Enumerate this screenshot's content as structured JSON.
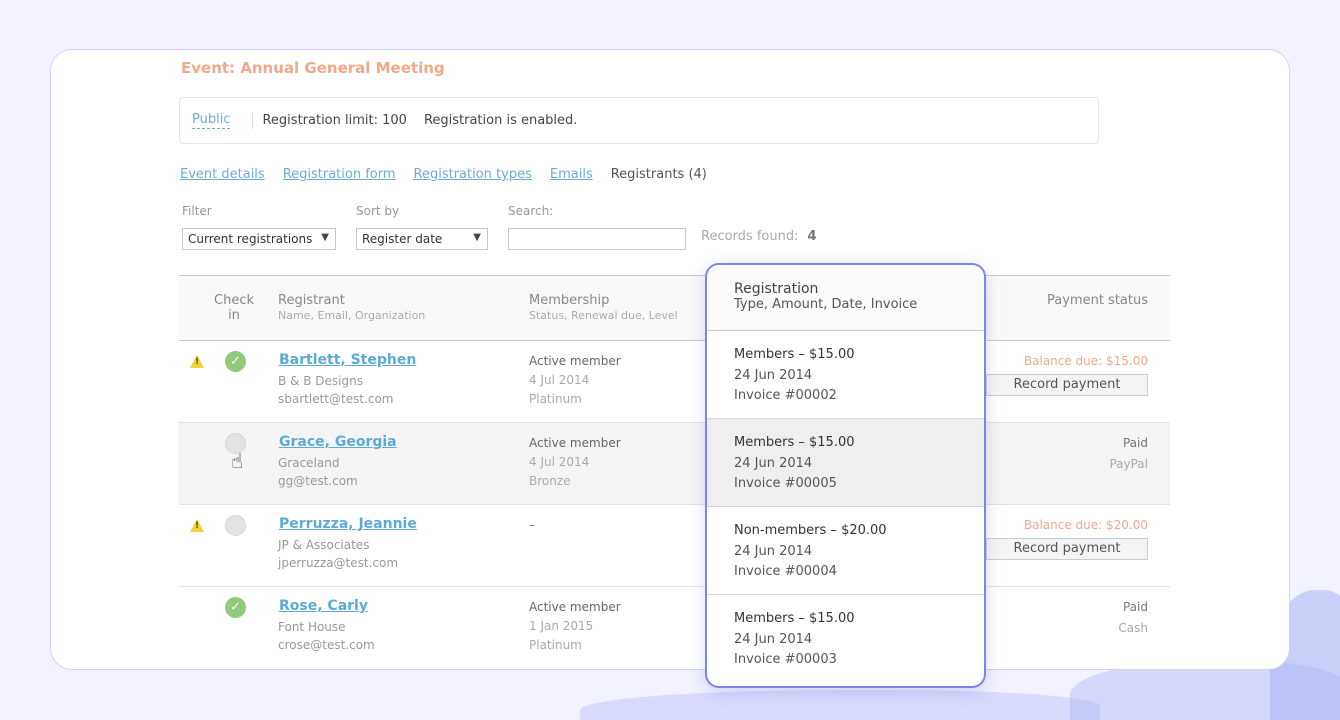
{
  "event": {
    "title": "Event: Annual General Meeting",
    "visibility": "Public",
    "registration_limit": "Registration limit: 100",
    "registration_status": "Registration is enabled."
  },
  "tabs": [
    {
      "label": "Event details",
      "active": false
    },
    {
      "label": "Registration form",
      "active": false
    },
    {
      "label": "Registration types",
      "active": false
    },
    {
      "label": "Emails",
      "active": false
    },
    {
      "label": "Registrants (4)",
      "active": true
    }
  ],
  "controls": {
    "filter_label": "Filter",
    "filter_value": "Current registrations",
    "sort_label": "Sort by",
    "sort_value": "Register date",
    "search_label": "Search:",
    "search_value": "",
    "records_label": "Records found:",
    "records_count": "4"
  },
  "table": {
    "headers": {
      "checkin": "Check in",
      "registrant": "Registrant",
      "registrant_sub": "Name, Email, Organization",
      "membership": "Membership",
      "membership_sub": "Status, Renewal due, Level",
      "payment": "Payment status"
    },
    "rows": [
      {
        "warning": true,
        "checked_in": true,
        "name": "Bartlett, Stephen",
        "org": "B & B Designs",
        "email": "sbartlett@test.com",
        "membership_status": "Active member",
        "renewal_due": "4 Jul 2014",
        "level": "Platinum",
        "payment_status": "Balance due: $15.00",
        "payment_action": "Record payment"
      },
      {
        "warning": false,
        "checked_in": false,
        "name": "Grace, Georgia",
        "org": "Graceland",
        "email": "gg@test.com",
        "membership_status": "Active member",
        "renewal_due": "4 Jul 2014",
        "level": "Bronze",
        "payment_status": "Paid",
        "payment_method": "PayPal"
      },
      {
        "warning": true,
        "checked_in": false,
        "name": "Perruzza, Jeannie",
        "org": "JP & Associates",
        "email": "jperruzza@test.com",
        "membership_status": "–",
        "payment_status": "Balance due: $20.00",
        "payment_action": "Record payment"
      },
      {
        "warning": false,
        "checked_in": true,
        "name": "Rose, Carly",
        "org": "Font House",
        "email": "crose@test.com",
        "membership_status": "Active member",
        "renewal_due": "1 Jan 2015",
        "level": "Platinum",
        "payment_status": "Paid",
        "payment_method": "Cash"
      }
    ]
  },
  "popup": {
    "title": "Registration",
    "subtitle": "Type, Amount, Date, Invoice",
    "items": [
      {
        "type_amount": "Members – $15.00",
        "date": "24 Jun 2014",
        "invoice": "Invoice #00002"
      },
      {
        "type_amount": "Members – $15.00",
        "date": "24 Jun 2014",
        "invoice": "Invoice #00005"
      },
      {
        "type_amount": "Non-members – $20.00",
        "date": "24 Jun 2014",
        "invoice": "Invoice #00004"
      },
      {
        "type_amount": "Members – $15.00",
        "date": "24 Jun 2014",
        "invoice": "Invoice #00003"
      }
    ]
  },
  "colors": {
    "accent_link": "#5eaad6",
    "event_title": "#f2a98a",
    "balance_due": "#f2a98a",
    "check_on": "#8fcb7a",
    "popup_border": "#7d84ef",
    "background": "#f1f2fd"
  },
  "icons": [
    "warning-icon",
    "check-circle-icon",
    "hand-cursor-icon",
    "dropdown-arrow-icon"
  ]
}
